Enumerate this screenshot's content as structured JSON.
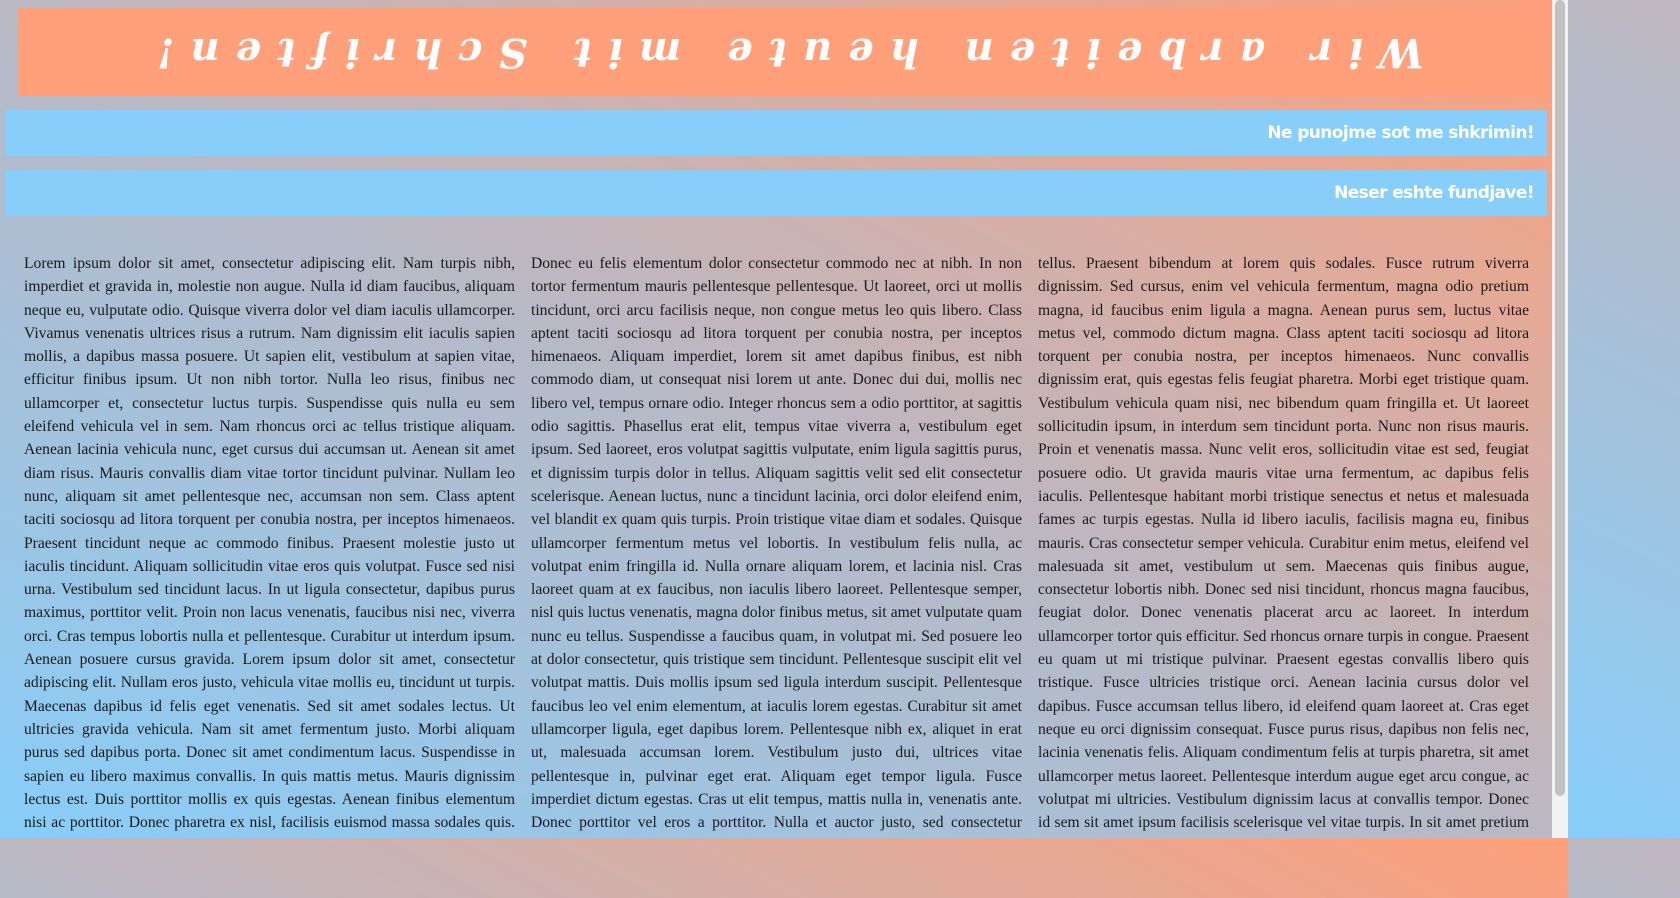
{
  "header": {
    "title": "Wir arbeiten heute mit Schriften!"
  },
  "notices": [
    {
      "text": "Ne punojme sot me shkrimin!"
    },
    {
      "text": "Neser eshte fundjave!"
    }
  ],
  "article": {
    "text": "Lorem ipsum dolor sit amet, consectetur adipiscing elit. Nam turpis nibh, imperdiet et gravida in, molestie non augue. Nulla id diam faucibus, aliquam neque eu, vulputate odio. Quisque viverra dolor vel diam iaculis ullamcorper. Vivamus venenatis ultrices risus a rutrum. Nam dignissim elit iaculis sapien mollis, a dapibus massa posuere. Ut sapien elit, vestibulum at sapien vitae, efficitur finibus ipsum. Ut non nibh tortor. Nulla leo risus, finibus nec ullamcorper et, consectetur luctus turpis. Suspendisse quis nulla eu sem eleifend vehicula vel in sem. Nam rhoncus orci ac tellus tristique aliquam. Aenean lacinia vehicula nunc, eget cursus dui accumsan ut. Aenean sit amet diam risus. Mauris convallis diam vitae tortor tincidunt pulvinar. Nullam leo nunc, aliquam sit amet pellentesque nec, accumsan non sem. Class aptent taciti sociosqu ad litora torquent per conubia nostra, per inceptos himenaeos. Praesent tincidunt neque ac commodo finibus. Praesent molestie justo ut iaculis tincidunt. Aliquam sollicitudin vitae eros quis volutpat. Fusce sed nisi urna. Vestibulum sed tincidunt lacus. In ut ligula consectetur, dapibus purus maximus, porttitor velit. Proin non lacus venenatis, faucibus nisi nec, viverra orci. Cras tempus lobortis nulla et pellentesque. Curabitur ut interdum ipsum. Aenean posuere cursus gravida. Lorem ipsum dolor sit amet, consectetur adipiscing elit. Nullam eros justo, vehicula vitae mollis eu, tincidunt ut turpis. Maecenas dapibus id felis eget venenatis. Sed sit amet sodales lectus. Ut ultricies gravida vehicula. Nam sit amet fermentum justo. Morbi aliquam purus sed dapibus porta. Donec sit amet condimentum lacus. Suspendisse in sapien eu libero maximus convallis. In quis mattis metus. Mauris dignissim lectus est. Duis porttitor mollis ex quis egestas. Aenean finibus elementum nisi ac porttitor. Donec pharetra ex nisl, facilisis euismod massa sodales quis. Donec eu felis elementum dolor consectetur commodo nec at nibh. In non tortor fermentum mauris pellentesque pellentesque. Ut laoreet, orci ut mollis tincidunt, orci arcu facilisis neque, non congue metus leo quis libero. Class aptent taciti sociosqu ad litora torquent per conubia nostra, per inceptos himenaeos. Aliquam imperdiet, lorem sit amet dapibus finibus, est nibh commodo diam, ut consequat nisi lorem ut ante. Donec dui dui, mollis nec libero vel, tempus ornare odio. Integer rhoncus sem a odio porttitor, at sagittis odio sagittis. Phasellus erat elit, tempus vitae viverra a, vestibulum eget ipsum. Sed laoreet, eros volutpat sagittis vulputate, enim ligula sagittis purus, et dignissim turpis dolor in tellus. Aliquam sagittis velit sed elit consectetur scelerisque. Aenean luctus, nunc a tincidunt lacinia, orci dolor eleifend enim, vel blandit ex quam quis turpis. Proin tristique vitae diam et sodales. Quisque ullamcorper fermentum metus vel lobortis. In vestibulum felis nulla, ac volutpat enim fringilla id. Nulla ornare aliquam lorem, et lacinia nisl. Cras laoreet quam at ex faucibus, non iaculis libero laoreet. Pellentesque semper, nisl quis luctus venenatis, magna dolor finibus metus, sit amet vulputate quam nunc eu tellus. Suspendisse a faucibus quam, in volutpat mi. Sed posuere leo at dolor consectetur, quis tristique sem tincidunt. Pellentesque suscipit elit vel volutpat mattis. Duis mollis ipsum sed ligula interdum suscipit. Pellentesque faucibus leo vel enim elementum, at iaculis lorem egestas. Curabitur sit amet ullamcorper ligula, eget dapibus lorem. Pellentesque nibh ex, aliquet in erat ut, malesuada accumsan lorem. Vestibulum justo dui, ultrices vitae pellentesque in, pulvinar eget erat. Aliquam eget tempor ligula. Fusce imperdiet dictum egestas. Cras ut elit tempus, mattis nulla in, venenatis ante. Donec porttitor vel eros a porttitor. Nulla et auctor justo, sed consectetur tellus. Praesent bibendum at lorem quis sodales. Fusce rutrum viverra dignissim. Sed cursus, enim vel vehicula fermentum, magna odio pretium magna, id faucibus enim ligula a magna. Aenean purus sem, luctus vitae metus vel, commodo dictum magna. Class aptent taciti sociosqu ad litora torquent per conubia nostra, per inceptos himenaeos. Nunc convallis dignissim erat, quis egestas felis feugiat pharetra. Morbi eget tristique quam. Vestibulum vehicula quam nisi, nec bibendum quam fringilla et. Ut laoreet sollicitudin ipsum, in interdum sem tincidunt porta. Nunc non risus mauris. Proin et venenatis massa. Nunc velit eros, sollicitudin vitae est sed, feugiat posuere odio. Ut gravida mauris vitae urna fermentum, ac dapibus felis iaculis. Pellentesque habitant morbi tristique senectus et netus et malesuada fames ac turpis egestas. Nulla id libero iaculis, facilisis magna eu, finibus mauris. Cras consectetur semper vehicula. Curabitur enim metus, eleifend vel malesuada sit amet, vestibulum ut sem. Maecenas quis finibus augue, consectetur lobortis nibh. Donec sed nisi tincidunt, rhoncus magna faucibus, feugiat dolor. Donec venenatis placerat arcu ac laoreet. In interdum ullamcorper tortor quis efficitur. Sed rhoncus ornare turpis in congue. Praesent eu quam ut mi tristique pulvinar. Praesent egestas convallis libero quis tristique. Fusce ultricies tristique orci. Aenean lacinia cursus dolor vel dapibus. Fusce accumsan tellus libero, id eleifend quam laoreet at. Cras eget neque eu orci dignissim consequat. Fusce purus risus, dapibus non felis nec, lacinia venenatis felis. Aliquam condimentum felis at turpis pharetra, sit amet ullamcorper metus laoreet. Pellentesque interdum augue eget arcu congue, ac volutpat mi ultricies. Vestibulum dignissim lacus at convallis tempor. Donec id sem sit amet ipsum facilisis scelerisque vel vitae turpis. In sit amet pretium purus. Maecenas tempus consectetur ante, non volutpat sapien eleifend eu. In condimentum, lectus vel mollis sollicitudin, nisl urna rutrum lacus, ut finibus odio turpis sit amet est. Ut in tristique neque. Nulla non fermentum orci. Donec vulputate elit laoreet felis tempor maximus."
  },
  "colors": {
    "banner_bg": "#ffa07a",
    "notice_bg": "#87cefa",
    "gradient_start": "#87cefa",
    "gradient_end": "#ffa07a",
    "heading_text": "#ffffff"
  }
}
